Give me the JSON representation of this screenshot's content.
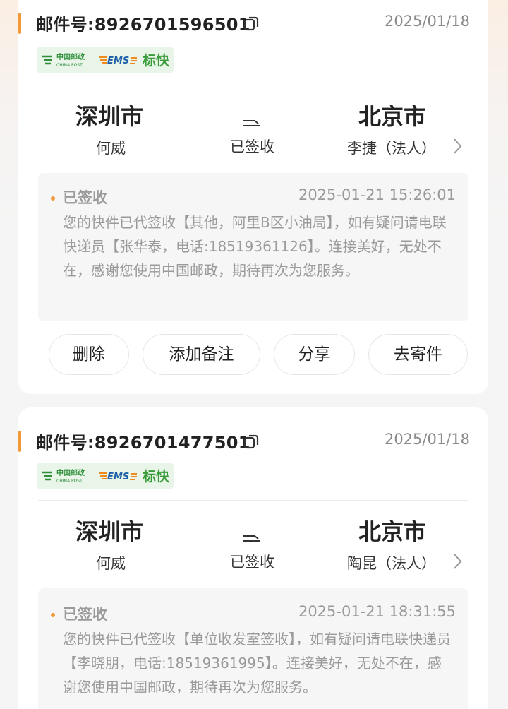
{
  "orders": [
    {
      "mail_no": "邮件号:8926701596501",
      "date": "2025/01/18",
      "tags": {
        "post_cn": "中国邮政",
        "post_en": "CHINA POST",
        "ems": "EMS",
        "fast": "标快"
      },
      "from_city": "深圳市",
      "from_person": "何威",
      "status": "已签收",
      "to_city": "北京市",
      "to_person": "李捷（法人）",
      "track_status": "已签收",
      "track_time": "2025-01-21 15:26:01",
      "track_desc": "您的快件已代签收【其他，阿里B区小油局】，如有疑问请电联快递员【张华泰，电话:18519361126】。连接美好，无处不在，感谢您使用中国邮政，期待再次为您服务。",
      "actions": [
        "删除",
        "添加备注",
        "分享",
        "去寄件"
      ]
    },
    {
      "mail_no": "邮件号:8926701477501",
      "date": "2025/01/18",
      "tags": {
        "post_cn": "中国邮政",
        "post_en": "CHINA POST",
        "ems": "EMS",
        "fast": "标快"
      },
      "from_city": "深圳市",
      "from_person": "何威",
      "status": "已签收",
      "to_city": "北京市",
      "to_person": "陶昆（法人）",
      "track_status": "已签收",
      "track_time": "2025-01-21 18:31:55",
      "track_desc": "您的快件已代签收【单位收发室签收】，如有疑问请电联快递员【李晓朋，电话:18519361995】。连接美好，无处不在，感谢您使用中国邮政，期待再次为您服务。"
    }
  ],
  "colors": {
    "accent": "#f29a38",
    "tag_bg": "#e8f5e8",
    "post_green": "#2f8f3a",
    "ems_blue": "#1f5fa8",
    "ems_orange": "#f08a1c",
    "muted": "#9a9a9a"
  }
}
